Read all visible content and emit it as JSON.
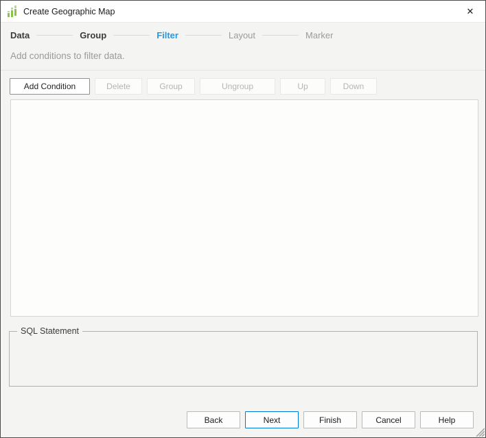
{
  "window": {
    "title": "Create Geographic Map",
    "close_glyph": "✕"
  },
  "colors": {
    "active_step_blue": "#1e9ce9",
    "default_button_border_blue": "#0078d7",
    "app_icon_green": "#8bc34a",
    "dialog_background": "#f4f4f2"
  },
  "steps": [
    {
      "label": "Data",
      "state": "done"
    },
    {
      "label": "Group",
      "state": "done"
    },
    {
      "label": "Filter",
      "state": "active"
    },
    {
      "label": "Layout",
      "state": "upcoming"
    },
    {
      "label": "Marker",
      "state": "upcoming"
    }
  ],
  "description": "Add conditions to filter data.",
  "toolbar": {
    "buttons": [
      {
        "label": "Add Condition",
        "enabled": true
      },
      {
        "label": "Delete",
        "enabled": false
      },
      {
        "label": "Group",
        "enabled": false
      },
      {
        "label": "Ungroup",
        "enabled": false
      },
      {
        "label": "Up",
        "enabled": false
      },
      {
        "label": "Down",
        "enabled": false
      }
    ]
  },
  "conditions": [],
  "sql_section": {
    "legend": "SQL Statement",
    "statement": ""
  },
  "footer": {
    "buttons": [
      {
        "label": "Back",
        "default": false
      },
      {
        "label": "Next",
        "default": true
      },
      {
        "label": "Finish",
        "default": false
      },
      {
        "label": "Cancel",
        "default": false
      },
      {
        "label": "Help",
        "default": false
      }
    ]
  }
}
